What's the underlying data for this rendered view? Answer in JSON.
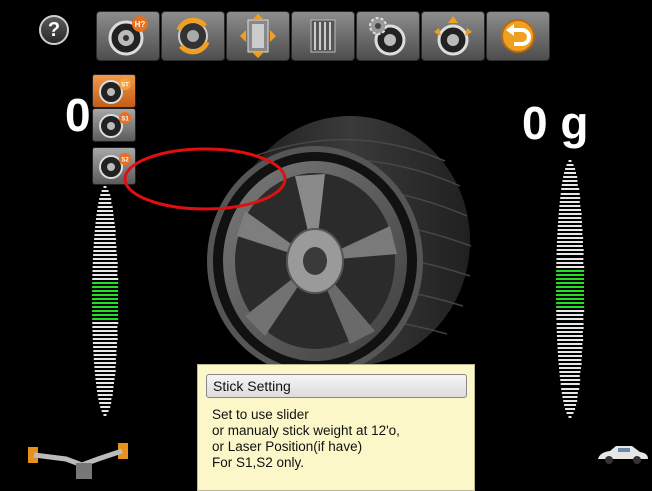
{
  "header": {
    "help_label": "?",
    "toolbar": [
      {
        "name": "wheel-help-button",
        "icon": "wheel-help-icon",
        "badge": "H?"
      },
      {
        "name": "rotate-button",
        "icon": "rotate-arrows-icon"
      },
      {
        "name": "position-button",
        "icon": "position-arrows-icon"
      },
      {
        "name": "grid-button",
        "icon": "grid-bars-icon"
      },
      {
        "name": "settings-button",
        "icon": "gear-wheel-icon"
      },
      {
        "name": "calibration-button",
        "icon": "wheel-arrows-icon"
      },
      {
        "name": "back-button",
        "icon": "undo-arrow-icon"
      }
    ]
  },
  "left_panel": {
    "value": "0",
    "menu": [
      {
        "name": "stick-mode-st",
        "badge": "ST",
        "state": "active"
      },
      {
        "name": "stick-mode-s1",
        "badge": "S1",
        "state": "normal"
      },
      {
        "name": "stick-mode-s2",
        "badge": "S2",
        "state": "normal"
      }
    ]
  },
  "right_panel": {
    "value": "0 g"
  },
  "tooltip": {
    "title": "Stick Setting",
    "lines": [
      "Set to use slider",
      "or manualy stick weight at 12'o,",
      "or Laser Position(if have)",
      "For S1,S2 only."
    ]
  },
  "colors": {
    "accent_orange": "#e8701e",
    "gauge_green": "#22e022",
    "gauge_white": "#e8e8e8",
    "highlight_red": "#e01010",
    "tooltip_bg": "#fbf7c8"
  }
}
